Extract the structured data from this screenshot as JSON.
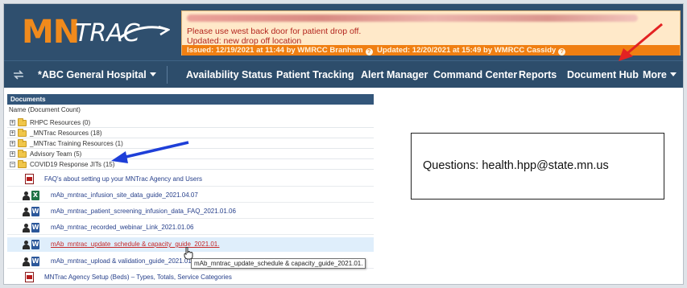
{
  "header": {
    "logo_mn": "MN",
    "logo_trac": "TRAC",
    "banner": {
      "line1": "Please use west back door for patient drop off.",
      "line2": "Updated: new drop off location",
      "issued": "Issued: 12/19/2021 at 11:44 by WMRCC Branham",
      "updated": "Updated: 12/20/2021 at 15:49 by WMRCC Cassidy",
      "help_glyph": "?"
    }
  },
  "nav": {
    "hospital": "*ABC General Hospital",
    "items": [
      {
        "label": "Availability Status"
      },
      {
        "label": "Patient Tracking"
      },
      {
        "label": "Alert Manager"
      },
      {
        "label": "Command Center"
      },
      {
        "label": "Reports"
      },
      {
        "label": "Document Hub"
      },
      {
        "label": "More"
      }
    ]
  },
  "documents": {
    "header": "Documents",
    "subheader": "Name (Document Count)",
    "folders": [
      {
        "label": "RHPC Resources (0)",
        "expander": "+"
      },
      {
        "label": "_MNTrac Resources (18)",
        "expander": "+"
      },
      {
        "label": "_MNTrac Training Resources (1)",
        "expander": "+"
      },
      {
        "label": "Advisory Team (5)",
        "expander": "+"
      },
      {
        "label": "COVID19 Response JITs (15)",
        "expander": "−"
      }
    ],
    "files": [
      {
        "label": "FAQ's about setting up your MNTrac Agency and Users",
        "type": "pdf"
      },
      {
        "label": "mAb_mntrac_infusion_site_data_guide_2021.04.07",
        "type": "excel"
      },
      {
        "label": "mAb_mntrac_patient_screening_infusion_data_FAQ_2021.01.06",
        "type": "word"
      },
      {
        "label": "mAb_mntrac_recorded_webinar_Link_2021.01.06",
        "type": "word"
      },
      {
        "label": "mAb_mntrac_update_schedule & capacity_guide_2021.01.",
        "type": "word"
      },
      {
        "label": "mAb_mntrac_upload & validation_guide_2021.01.06",
        "type": "word"
      },
      {
        "label": "MNTrac Agency Setup (Beds) – Types, Totals, Service Categories",
        "type": "pdf"
      }
    ],
    "word_glyph": "W",
    "excel_glyph": "X",
    "tooltip": "mAb_mntrac_update_schedule & capacity_guide_2021.01."
  },
  "callout": {
    "questions": "Questions: health.hpp@state.mn.us"
  },
  "colors": {
    "header_bg": "#2f4f6e",
    "accent_orange": "#f07f12",
    "arrow_red": "#e32222",
    "arrow_blue": "#1e3fd8",
    "link_blue": "#27408b"
  }
}
